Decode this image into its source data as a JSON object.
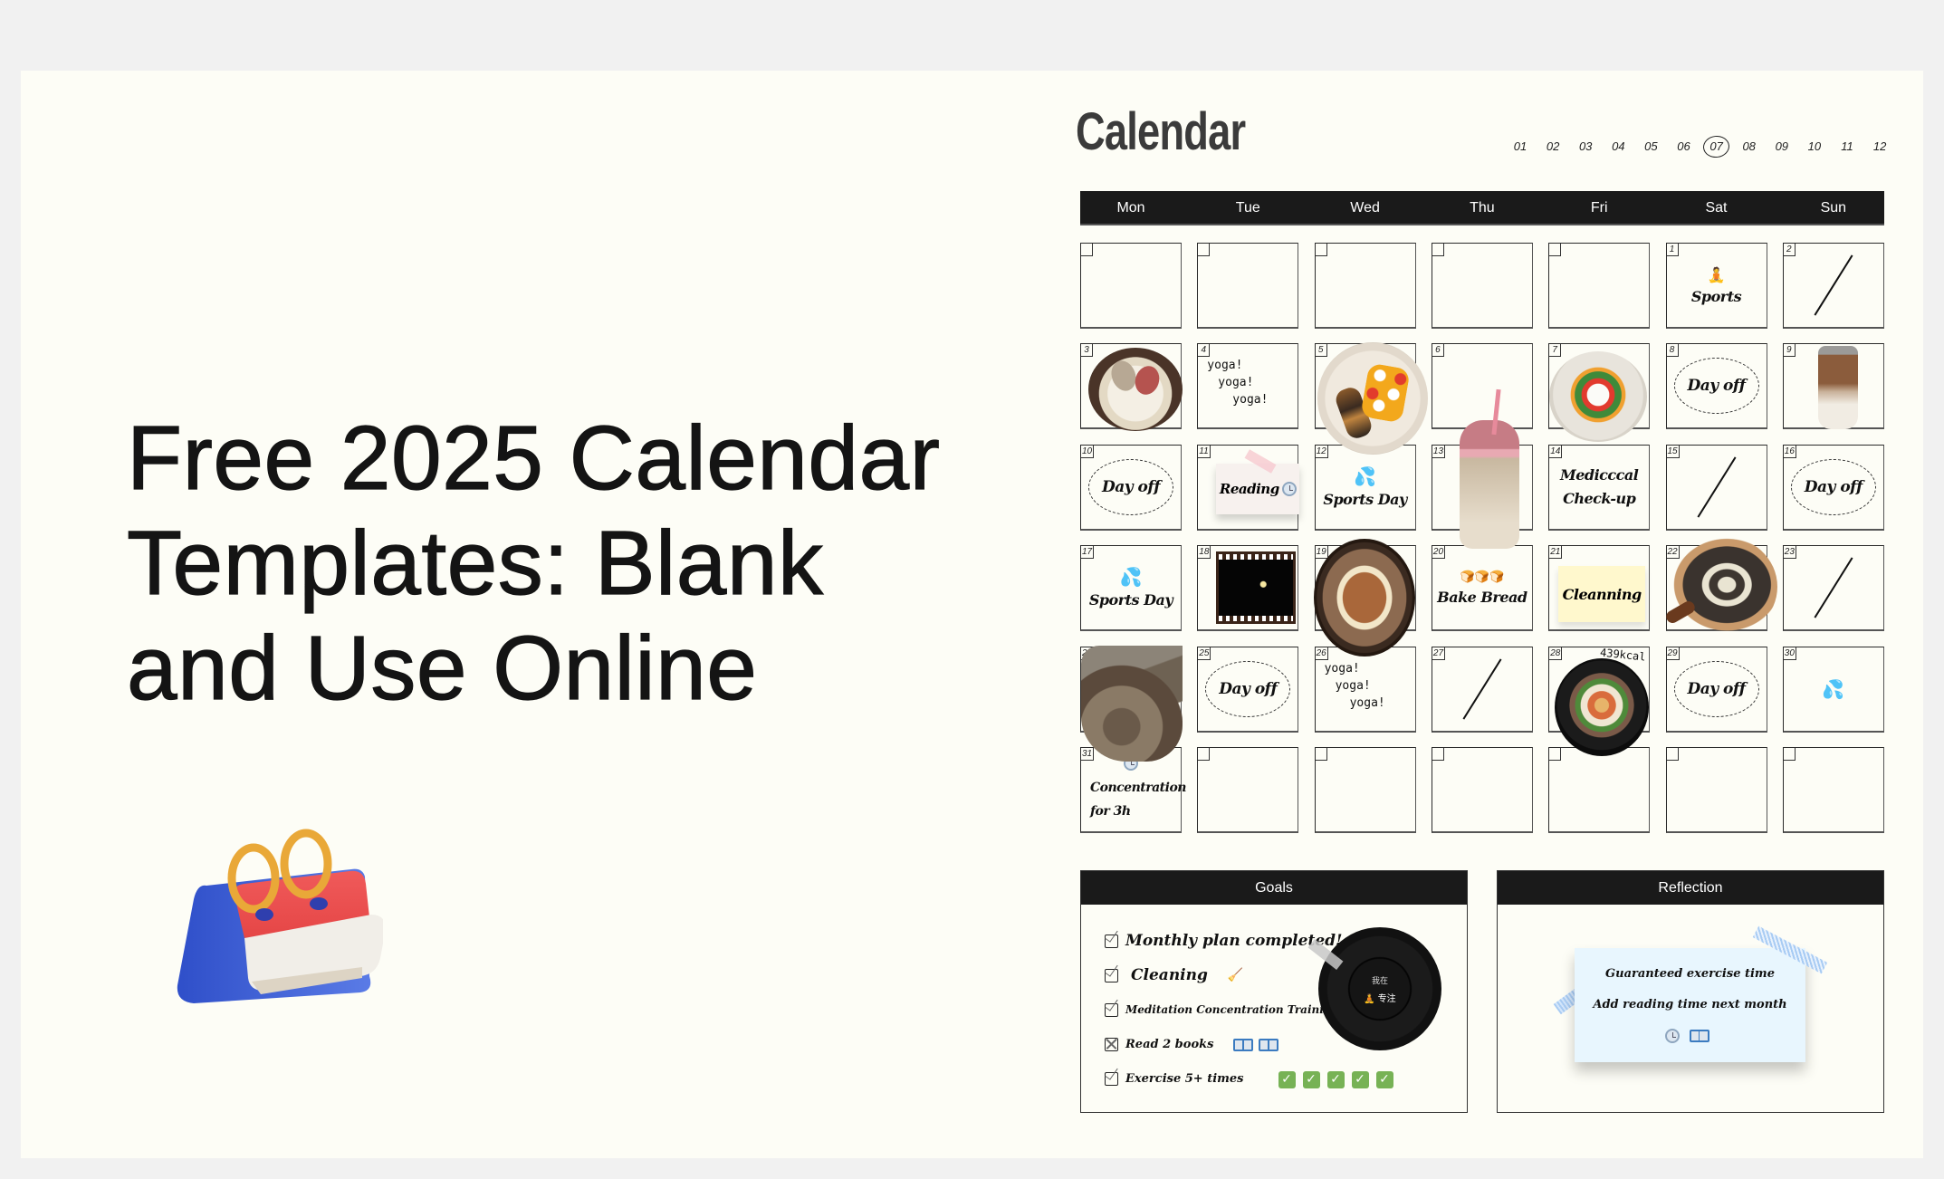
{
  "hero": {
    "title_lines": [
      "Free 2025 Calendar",
      "Templates: Blank",
      "and Use Online"
    ],
    "icon": "desk-calendar-icon"
  },
  "calendar": {
    "heading": "Calendar",
    "months": [
      "01",
      "02",
      "03",
      "04",
      "05",
      "06",
      "07",
      "08",
      "09",
      "10",
      "11",
      "12"
    ],
    "selected_month": "07",
    "weekdays": [
      "Mon",
      "Tue",
      "Wed",
      "Thu",
      "Fri",
      "Sat",
      "Sun"
    ],
    "weeks": [
      [
        {
          "day": ""
        },
        {
          "day": ""
        },
        {
          "day": ""
        },
        {
          "day": ""
        },
        {
          "day": ""
        },
        {
          "day": "1",
          "type": "label",
          "label": "Sports",
          "icon": "meditation-person-icon"
        },
        {
          "day": "2",
          "type": "slash"
        }
      ],
      [
        {
          "day": "3",
          "type": "photo",
          "photo": "shaved-ice-bowl"
        },
        {
          "day": "4",
          "type": "yoga",
          "lines": [
            "yoga!",
            "yoga!",
            "yoga!"
          ]
        },
        {
          "day": "5",
          "type": "photo",
          "photo": "fruit-plate"
        },
        {
          "day": "6"
        },
        {
          "day": "7",
          "type": "photo",
          "photo": "burrata-salad"
        },
        {
          "day": "8",
          "type": "dayoff",
          "label": "Day off"
        },
        {
          "day": "9",
          "type": "photo",
          "photo": "iced-latte"
        }
      ],
      [
        {
          "day": "10",
          "type": "dayoff",
          "label": "Day off"
        },
        {
          "day": "11",
          "type": "note",
          "label": "Reading",
          "icon": "clock-icon"
        },
        {
          "day": "12",
          "type": "label",
          "label": "Sports Day",
          "icon": "sweat-drops-icon"
        },
        {
          "day": "13",
          "type": "photo",
          "photo": "pink-cup-drink"
        },
        {
          "day": "14",
          "type": "label2",
          "lines": [
            "Medicccal",
            "Check-up"
          ]
        },
        {
          "day": "15",
          "type": "slash"
        },
        {
          "day": "16",
          "type": "dayoff",
          "label": "Day off"
        }
      ],
      [
        {
          "day": "17",
          "type": "label",
          "label": "Sports Day",
          "icon": "sweat-drops-icon"
        },
        {
          "day": "18",
          "type": "photo",
          "photo": "film-moon"
        },
        {
          "day": "19",
          "type": "photo",
          "photo": "granola-bowl"
        },
        {
          "day": "20",
          "type": "label",
          "label": "Bake Bread",
          "icon": "bread-icon"
        },
        {
          "day": "21",
          "type": "sticky",
          "label": "Cleanning"
        },
        {
          "day": "22",
          "type": "photo",
          "photo": "pizza-board"
        },
        {
          "day": "23",
          "type": "slash"
        }
      ],
      [
        {
          "day": "24",
          "type": "photo",
          "photo": "cat"
        },
        {
          "day": "25",
          "type": "dayoff",
          "label": "Day off"
        },
        {
          "day": "26",
          "type": "yoga",
          "lines": [
            "yoga!",
            "yoga!",
            "yoga!"
          ]
        },
        {
          "day": "27",
          "type": "slash"
        },
        {
          "day": "28",
          "type": "photo",
          "photo": "bibimbap",
          "note": "439kcal"
        },
        {
          "day": "29",
          "type": "dayoff",
          "label": "Day off"
        },
        {
          "day": "30",
          "type": "icon",
          "icon": "sweat-drops-icon"
        }
      ],
      [
        {
          "day": "31",
          "type": "label2",
          "lines": [
            "Concentration",
            "for 3h"
          ],
          "icon": "clock-icon"
        },
        {
          "day": ""
        },
        {
          "day": ""
        },
        {
          "day": ""
        },
        {
          "day": ""
        },
        {
          "day": ""
        },
        {
          "day": ""
        }
      ]
    ],
    "glyphs": {
      "drops": "💦",
      "meditation": "🧘",
      "bread": "🍞🍞🍞",
      "broom": "🧹",
      "check": "✓"
    }
  },
  "goals": {
    "title": "Goals",
    "items": [
      {
        "label": "Monthly plan completed!",
        "state": "checked"
      },
      {
        "label": "Cleaning",
        "state": "checked",
        "extra": "broom-icon"
      },
      {
        "label": "Meditation Concentration Training",
        "state": "checked",
        "extra": "clock-icon"
      },
      {
        "label": "Read 2 books",
        "state": "crossed",
        "extra": "books-icon"
      },
      {
        "label": "Exercise 5+ times",
        "state": "checked",
        "extra": "green-checks",
        "check_count": 5
      }
    ],
    "vinyl": {
      "top_text": "我在",
      "bottom_text": "专注"
    }
  },
  "reflection": {
    "title": "Reflection",
    "lines": [
      "Guaranteed exercise time",
      "Add reading time next month"
    ]
  }
}
